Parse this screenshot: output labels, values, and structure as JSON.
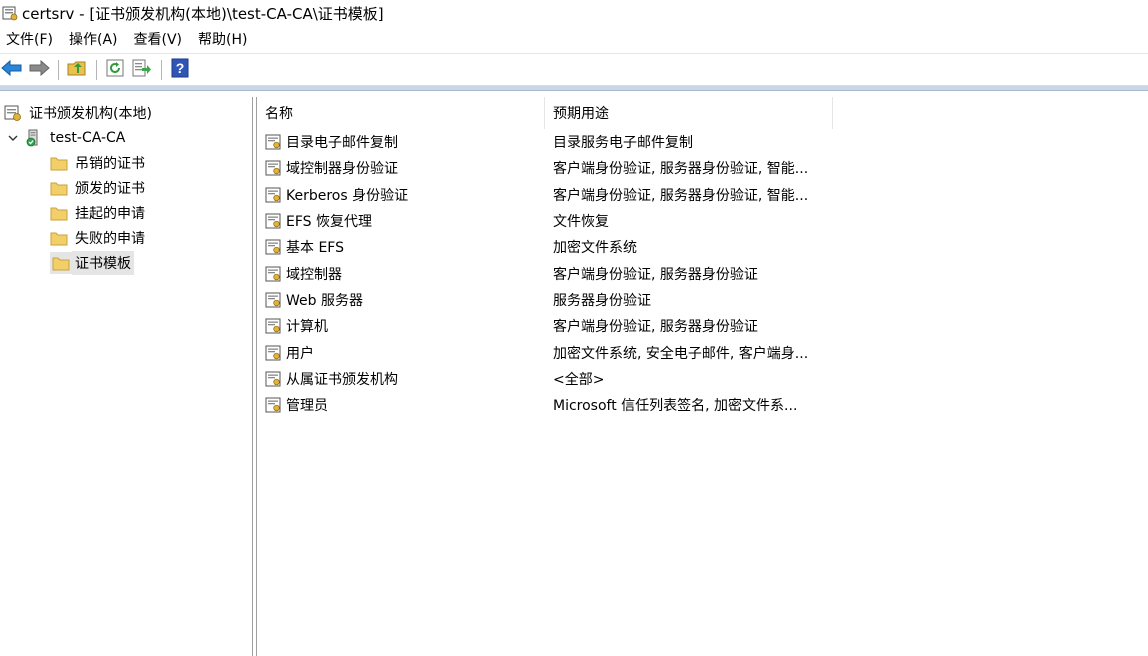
{
  "window": {
    "title": "certsrv - [证书颁发机构(本地)\\test-CA-CA\\证书模板]"
  },
  "menu": [
    {
      "label": "文件(F)"
    },
    {
      "label": "操作(A)"
    },
    {
      "label": "查看(V)"
    },
    {
      "label": "帮助(H)"
    }
  ],
  "toolbar": {
    "buttons": [
      "back-icon",
      "forward-icon",
      "up-folder-icon",
      "refresh-icon",
      "export-list-icon",
      "help-icon"
    ]
  },
  "tree": {
    "root": {
      "label": "证书颁发机构(本地)",
      "icon": "ca-root-icon"
    },
    "ca": {
      "label": "test-CA-CA",
      "icon": "ca-server-icon",
      "expanded": true
    },
    "folders": [
      {
        "label": "吊销的证书",
        "icon": "folder-icon"
      },
      {
        "label": "颁发的证书",
        "icon": "folder-icon"
      },
      {
        "label": "挂起的申请",
        "icon": "folder-icon"
      },
      {
        "label": "失败的申请",
        "icon": "folder-icon"
      },
      {
        "label": "证书模板",
        "icon": "folder-icon",
        "selected": true
      }
    ]
  },
  "list": {
    "columns": [
      "名称",
      "预期用途"
    ],
    "rows": [
      {
        "name": "目录电子邮件复制",
        "purpose": "目录服务电子邮件复制"
      },
      {
        "name": "域控制器身份验证",
        "purpose": "客户端身份验证, 服务器身份验证, 智能..."
      },
      {
        "name": "Kerberos 身份验证",
        "purpose": "客户端身份验证, 服务器身份验证, 智能..."
      },
      {
        "name": "EFS 恢复代理",
        "purpose": "文件恢复"
      },
      {
        "name": "基本 EFS",
        "purpose": "加密文件系统"
      },
      {
        "name": "域控制器",
        "purpose": "客户端身份验证, 服务器身份验证"
      },
      {
        "name": "Web 服务器",
        "purpose": "服务器身份验证"
      },
      {
        "name": "计算机",
        "purpose": "客户端身份验证, 服务器身份验证"
      },
      {
        "name": "用户",
        "purpose": "加密文件系统, 安全电子邮件, 客户端身..."
      },
      {
        "name": "从属证书颁发机构",
        "purpose": "<全部>"
      },
      {
        "name": "管理员",
        "purpose": "Microsoft 信任列表签名, 加密文件系..."
      }
    ]
  },
  "colors": {
    "accent": "#1f6fc5",
    "folder": "#f3cf6a",
    "pane_header": "#c9d7e8",
    "selection": "#e5e5e5"
  }
}
